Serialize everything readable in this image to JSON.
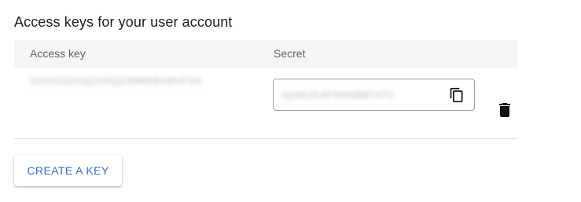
{
  "section": {
    "title": "Access keys for your user account"
  },
  "table": {
    "columns": [
      "Access key",
      "Secret"
    ],
    "rows": [
      {
        "access_key": "GOOG1EA3Q2X5QZ4NRKBXMVFXA",
        "secret": "bySK1EAFR0rNB8T47U",
        "copy_icon": "copy-icon",
        "delete_icon": "trash-icon"
      }
    ]
  },
  "actions": {
    "create_label": "CREATE A KEY"
  },
  "colors": {
    "accent": "#3b6ed4",
    "header_bg": "#f5f5f5",
    "text": "#202124",
    "muted": "#5f6368"
  }
}
